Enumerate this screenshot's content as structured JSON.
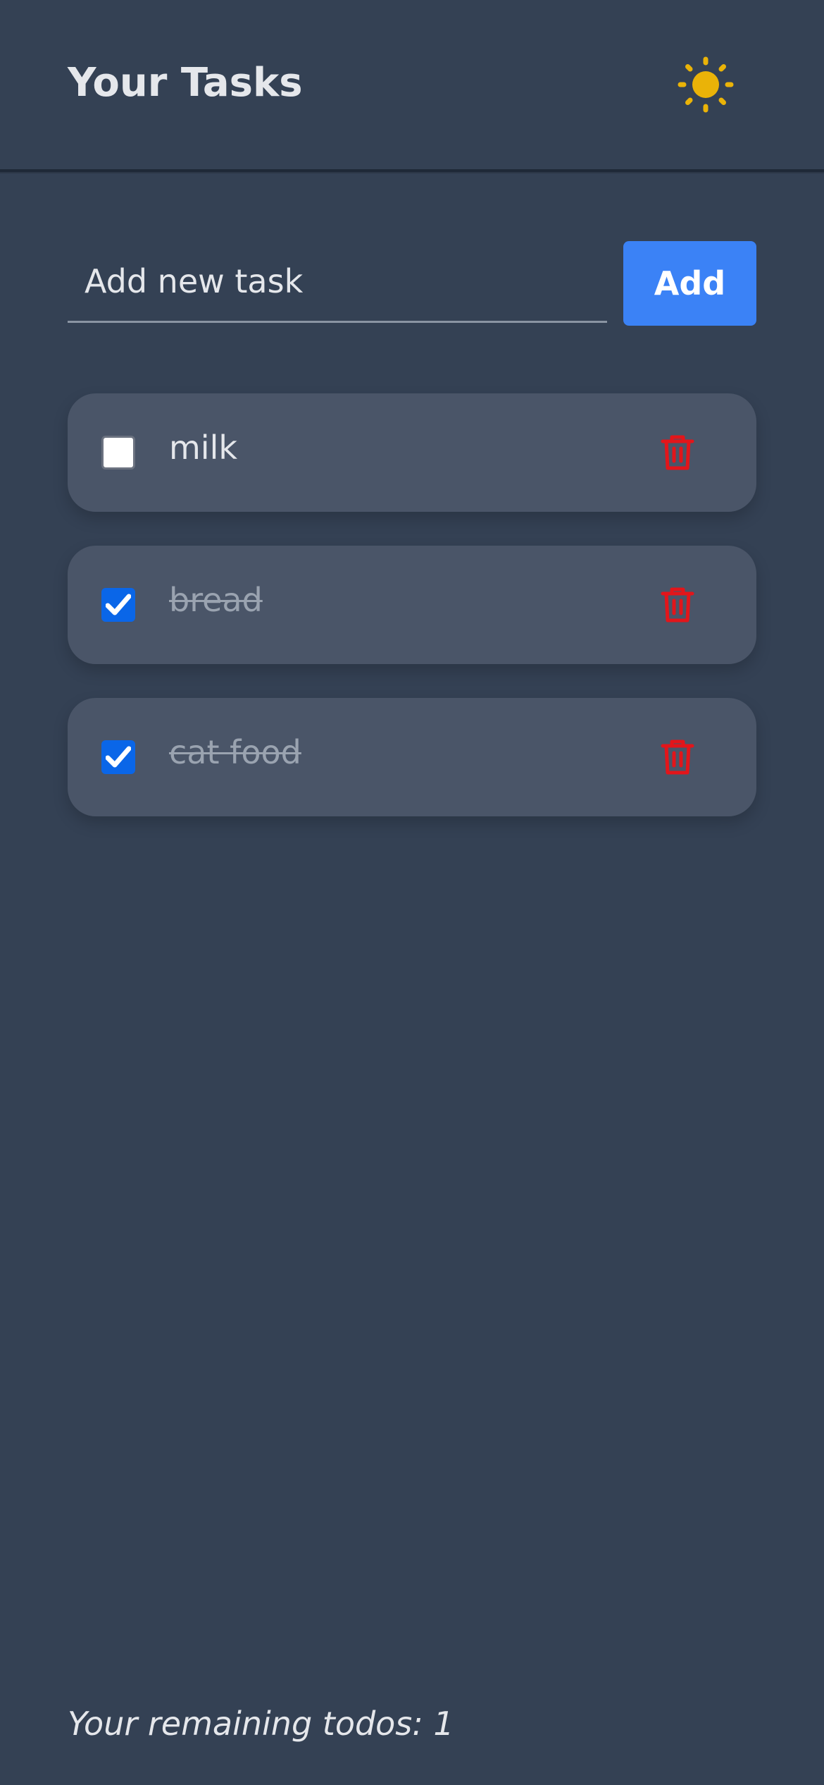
{
  "header": {
    "title": "Your Tasks",
    "theme_icon": "sun-icon",
    "theme_icon_color": "#eab308"
  },
  "add_form": {
    "placeholder": "Add new task",
    "value": "",
    "button_label": "Add",
    "button_color": "#3b82f6"
  },
  "tasks": [
    {
      "label": "milk",
      "completed": false,
      "delete_icon": "trash-icon"
    },
    {
      "label": "bread",
      "completed": true,
      "delete_icon": "trash-icon"
    },
    {
      "label": "cat food",
      "completed": true,
      "delete_icon": "trash-icon"
    }
  ],
  "footer": {
    "remaining_text": "Your remaining todos: 1"
  },
  "colors": {
    "background": "#344154",
    "card": "#4a5568",
    "delete": "#e3151a",
    "checkbox_checked": "#0a66e8"
  }
}
